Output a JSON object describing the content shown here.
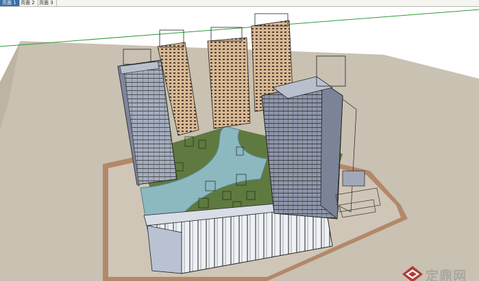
{
  "tabs": [
    {
      "label": "页面 1",
      "active": true
    },
    {
      "label": "页面 2",
      "active": false
    },
    {
      "label": "页面 3",
      "active": false
    }
  ],
  "watermark": {
    "text": "定鼎网"
  },
  "colors": {
    "sky": "#ffffff",
    "ground": "#c9c1b2",
    "site_plinth": "#b3886a",
    "podium": "#e8ecf2",
    "lawn": "#5f7a40",
    "water": "#8cb8c0",
    "tower_facade": "#d9b994",
    "glass_tower": "#9aa4b8",
    "selection_box": "#000000",
    "horizon_line": "#2f9a3a"
  }
}
